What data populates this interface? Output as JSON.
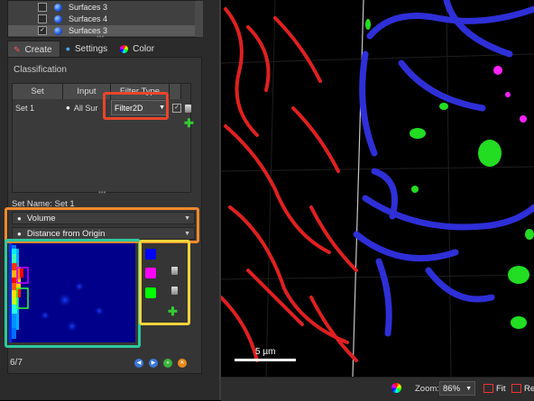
{
  "surfaces_list": {
    "items": [
      {
        "label": "Surfaces 3",
        "checked": false,
        "selected": false
      },
      {
        "label": "Surfaces 4",
        "checked": false,
        "selected": false
      },
      {
        "label": "Surfaces 3",
        "checked": true,
        "selected": true
      }
    ]
  },
  "tabs": [
    {
      "label": "Create",
      "icon": "wand-icon",
      "active": true
    },
    {
      "label": "Settings",
      "icon": "surfaces-icon",
      "active": false
    },
    {
      "label": "Color",
      "icon": "color-wheel-icon",
      "active": false
    }
  ],
  "classification": {
    "title": "Classification",
    "columns": [
      "Set",
      "Input",
      "Filter Type"
    ],
    "row": {
      "set": "Set 1",
      "input": "All Sur",
      "filter_type": "Filter2D",
      "checked": true
    }
  },
  "set_name": "Set Name: Set 1",
  "dropdowns": {
    "x_axis": "Volume",
    "y_axis": "Distance from Origin"
  },
  "classes": [
    {
      "color": "#0000ff"
    },
    {
      "color": "#ff00ff"
    },
    {
      "color": "#00ff00"
    }
  ],
  "footer": {
    "count": "6/7"
  },
  "viewer": {
    "scalebar": "5 µm"
  },
  "bottombar": {
    "zoom_label": "Zoom:",
    "zoom_value": "86%",
    "fit_label": "Fit",
    "reset_label": "Re"
  },
  "highlights": {
    "filter": "#e8452b",
    "dropdowns": "#f08a2c",
    "heatmap": "#2ec9a0",
    "classes": "#f5d33b"
  }
}
